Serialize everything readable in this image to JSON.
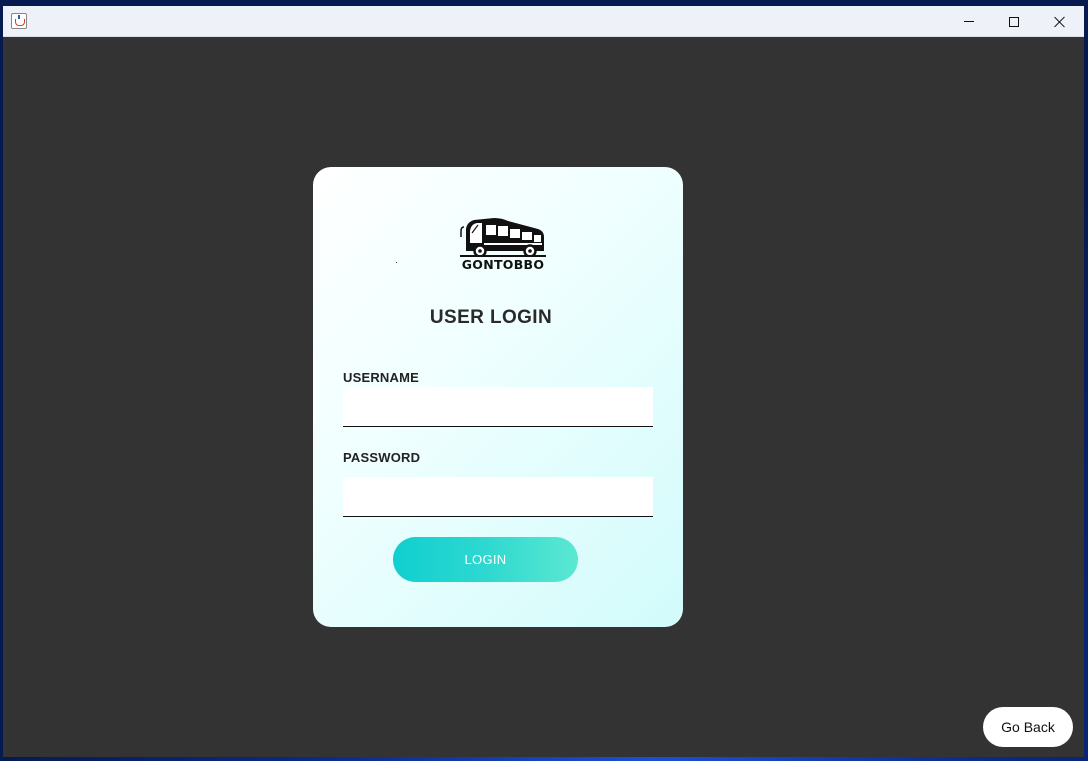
{
  "window": {
    "icon": "java-cup-icon",
    "controls": {
      "minimize": "minimize-icon",
      "maximize": "maximize-icon",
      "close": "close-icon"
    }
  },
  "login_card": {
    "logo": {
      "icon": "bus-icon",
      "text": "GONTOBBO"
    },
    "title": "USER LOGIN",
    "username": {
      "label": "USERNAME",
      "value": "",
      "placeholder": ""
    },
    "password": {
      "label": "PASSWORD",
      "value": "",
      "placeholder": ""
    },
    "login_button": "LOGIN",
    "colors": {
      "button_gradient_start": "#10cfcf",
      "button_gradient_end": "#5ce8d2",
      "card_tint": "#d2fbfb"
    }
  },
  "go_back_button": "Go Back",
  "colors": {
    "window_background": "#333333",
    "titlebar": "#eef1f8"
  }
}
